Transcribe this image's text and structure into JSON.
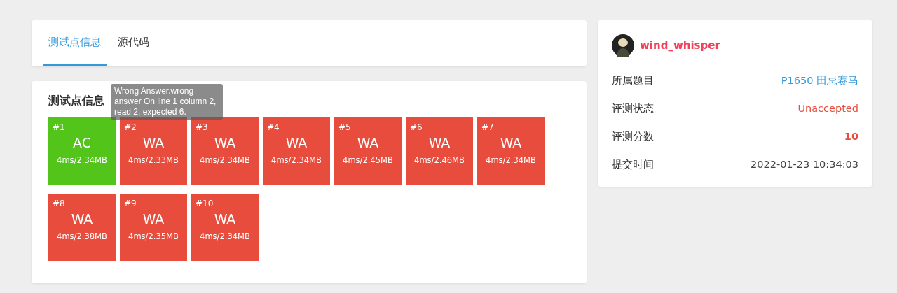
{
  "tabs": [
    {
      "label": "测试点信息",
      "selected": true
    },
    {
      "label": "源代码",
      "selected": false
    }
  ],
  "testcases": {
    "title": "测试点信息",
    "tooltip": "Wrong Answer.wrong answer On line 1 column 2, read 2, expected 6.",
    "items": [
      {
        "index": "#1",
        "verdict": "AC",
        "usage": "4ms/2.34MB"
      },
      {
        "index": "#2",
        "verdict": "WA",
        "usage": "4ms/2.33MB"
      },
      {
        "index": "#3",
        "verdict": "WA",
        "usage": "4ms/2.34MB"
      },
      {
        "index": "#4",
        "verdict": "WA",
        "usage": "4ms/2.34MB"
      },
      {
        "index": "#5",
        "verdict": "WA",
        "usage": "4ms/2.45MB"
      },
      {
        "index": "#6",
        "verdict": "WA",
        "usage": "4ms/2.46MB"
      },
      {
        "index": "#7",
        "verdict": "WA",
        "usage": "4ms/2.34MB"
      },
      {
        "index": "#8",
        "verdict": "WA",
        "usage": "4ms/2.38MB"
      },
      {
        "index": "#9",
        "verdict": "WA",
        "usage": "4ms/2.35MB"
      },
      {
        "index": "#10",
        "verdict": "WA",
        "usage": "4ms/2.34MB"
      }
    ]
  },
  "submission": {
    "user": "wind_whisper",
    "fields": [
      {
        "label": "所属题目",
        "value": "P1650 田忌赛马",
        "kind": "link"
      },
      {
        "label": "评测状态",
        "value": "Unaccepted",
        "kind": "status"
      },
      {
        "label": "评测分数",
        "value": "10",
        "kind": "score"
      },
      {
        "label": "提交时间",
        "value": "2022-01-23 10:34:03",
        "kind": "plain"
      }
    ]
  }
}
